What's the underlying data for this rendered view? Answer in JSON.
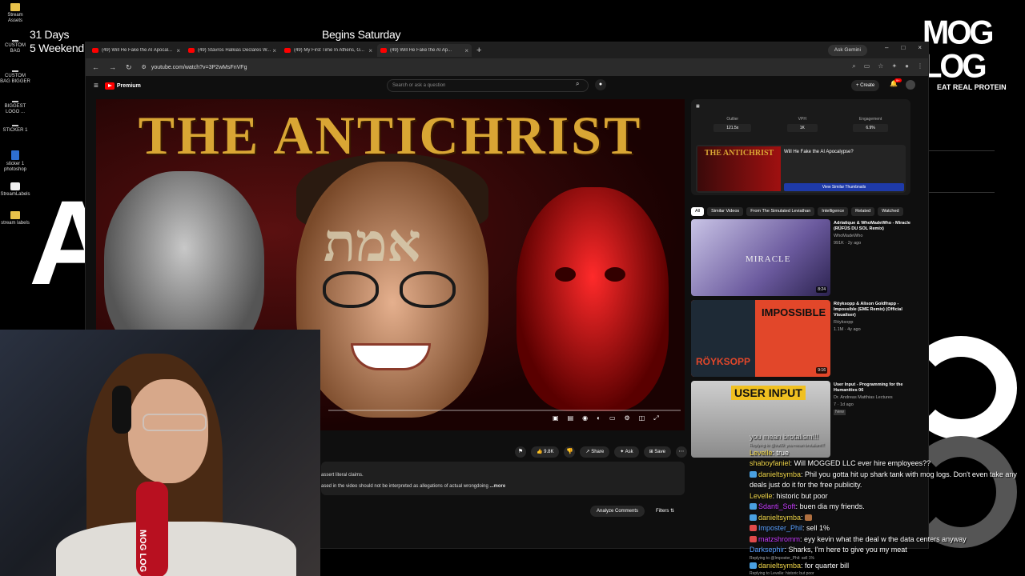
{
  "desktop": {
    "icons": [
      {
        "label": "Stream\nAssets",
        "icon": "folder-icon"
      },
      {
        "label": "CUSTOM\nBAG",
        "icon": "dash-icon"
      },
      {
        "label": "CUSTOM\nBAG BIGGER",
        "icon": "dash-icon"
      },
      {
        "label": "BIGGEST\nLOGO ...",
        "icon": "dash-icon"
      },
      {
        "label": "STICKER 1",
        "icon": "dash-icon"
      },
      {
        "label": "sticker 1\nphotoshop",
        "icon": "photoshop-doc-icon"
      },
      {
        "label": "StreamLabels",
        "icon": "app-icon"
      },
      {
        "label": "stream labels",
        "icon": "folder-icon"
      }
    ],
    "overlay_days": "31 Days",
    "overlay_weekends": "5 Weekend",
    "overlay_begins": "Begins Saturday",
    "big_letter": "A"
  },
  "moglog": {
    "logo": "MOG LOG",
    "tagline": "EAT REAL PROTEIN"
  },
  "browser": {
    "tabs": [
      {
        "title": "(49) Will He Fake the AI Apocal..."
      },
      {
        "title": "(49) Stavros Halkias Declares W..."
      },
      {
        "title": "(49) My First Time In Athens, G..."
      },
      {
        "title": "(49) Will He Fake the AI Ap..."
      }
    ],
    "gemini": "Ask Gemini",
    "url": "youtube.com/watch?v=3P2wMsFnVFg"
  },
  "youtube": {
    "premium": "Premium",
    "search_placeholder": "Search or ask a question",
    "create": "+ Create",
    "notif_count": "9+",
    "thumb_title": "THE ANTICHRIST",
    "hebrew": "אמת",
    "actions": {
      "likes": "9.8K",
      "share": "Share",
      "ask": "Ask",
      "save": "Save"
    },
    "desc_line1": "assert literal claims.",
    "desc_line2": "ased in the video should not be interpreted as allegations of actual wrongdoing",
    "desc_more": "...more",
    "analyze": "Analyze Comments",
    "filters": "Filters"
  },
  "extension": {
    "stats": [
      {
        "label": "Outlier",
        "value": "121.5x"
      },
      {
        "label": "VPH",
        "value": "1K"
      },
      {
        "label": "Engagement",
        "value": "6.9%"
      }
    ],
    "card_title": "Will He Fake the AI Apocalypse?",
    "card_thumb_text": "THE ANTICHRIST",
    "card_button": "View Similar Thumbnails"
  },
  "chips": [
    "All",
    "Similar Videos",
    "From The Simulated Leviathan",
    "Intelligence",
    "Related",
    "Watched"
  ],
  "recommendations": [
    {
      "title": "Adriatique & WhoMadeWho - Miracle (RÜFÜS DU SOL Remix)",
      "channel": "WhoMadeWho",
      "stats": "991K · 2y ago",
      "duration": "8:24",
      "thumb_text": "MIRACLE"
    },
    {
      "title": "Röyksopp & Alison Goldfrapp - Impossible (EME Remix) (Official Visualiser)",
      "channel": "Röyksopp",
      "stats": "1.1M · 4y ago",
      "duration": "9:16",
      "thumb_text": "IMPOSSIBLE",
      "thumb_text2": "RÖYKSOPP"
    },
    {
      "title": "User Input - Programming for the Humanities 06",
      "channel": "Dr. Andreas Matthias Lectures",
      "stats": "7 · 1d ago",
      "duration": "",
      "thumb_text": "USER INPUT",
      "badge": "New"
    }
  ],
  "webcam": {
    "mic_label": "MOG LOG"
  },
  "chat": [
    {
      "user": "",
      "text": "you mean brotalism!!!",
      "color": "#cccccc"
    },
    {
      "reply": "Replying to @tru09: you mean brotalism!!!"
    },
    {
      "user": "Levelle",
      "text": "true",
      "color": "#f0d64a"
    },
    {
      "user": "shaboyfaniel",
      "text": "Will MOGGED LLC ever hire employees??",
      "color": "#f0d64a"
    },
    {
      "user": "danieltsymba",
      "text": "Phil you gotta hit up shark tank with mog logs. Don't even take any deals just do it for the free publicity.",
      "color": "#f0d64a"
    },
    {
      "user": "Levelle",
      "text": "historic but poor",
      "color": "#f0d64a"
    },
    {
      "user": "Sdanti_Soft",
      "text": "buen dia my friends.",
      "color": "#c83cff"
    },
    {
      "user": "danieltsymba",
      "text": "",
      "color": "#f0d64a"
    },
    {
      "user": "Imposter_Phil",
      "text": "sell 1%",
      "color": "#5aa0ff"
    },
    {
      "user": "matzshromm",
      "text": "eyy kevin what the deal w the data centers anyway",
      "color": "#c83cff"
    },
    {
      "user": "Darksephir",
      "text": "Sharks, I'm here to give you my meat",
      "color": "#5aa0ff"
    },
    {
      "reply": "Replying to @Imposter_Phil: sell 1%"
    },
    {
      "user": "danieltsymba",
      "text": "for quarter bill",
      "color": "#f0d64a"
    },
    {
      "reply": "Replying to Levelle: historic but poor"
    }
  ]
}
